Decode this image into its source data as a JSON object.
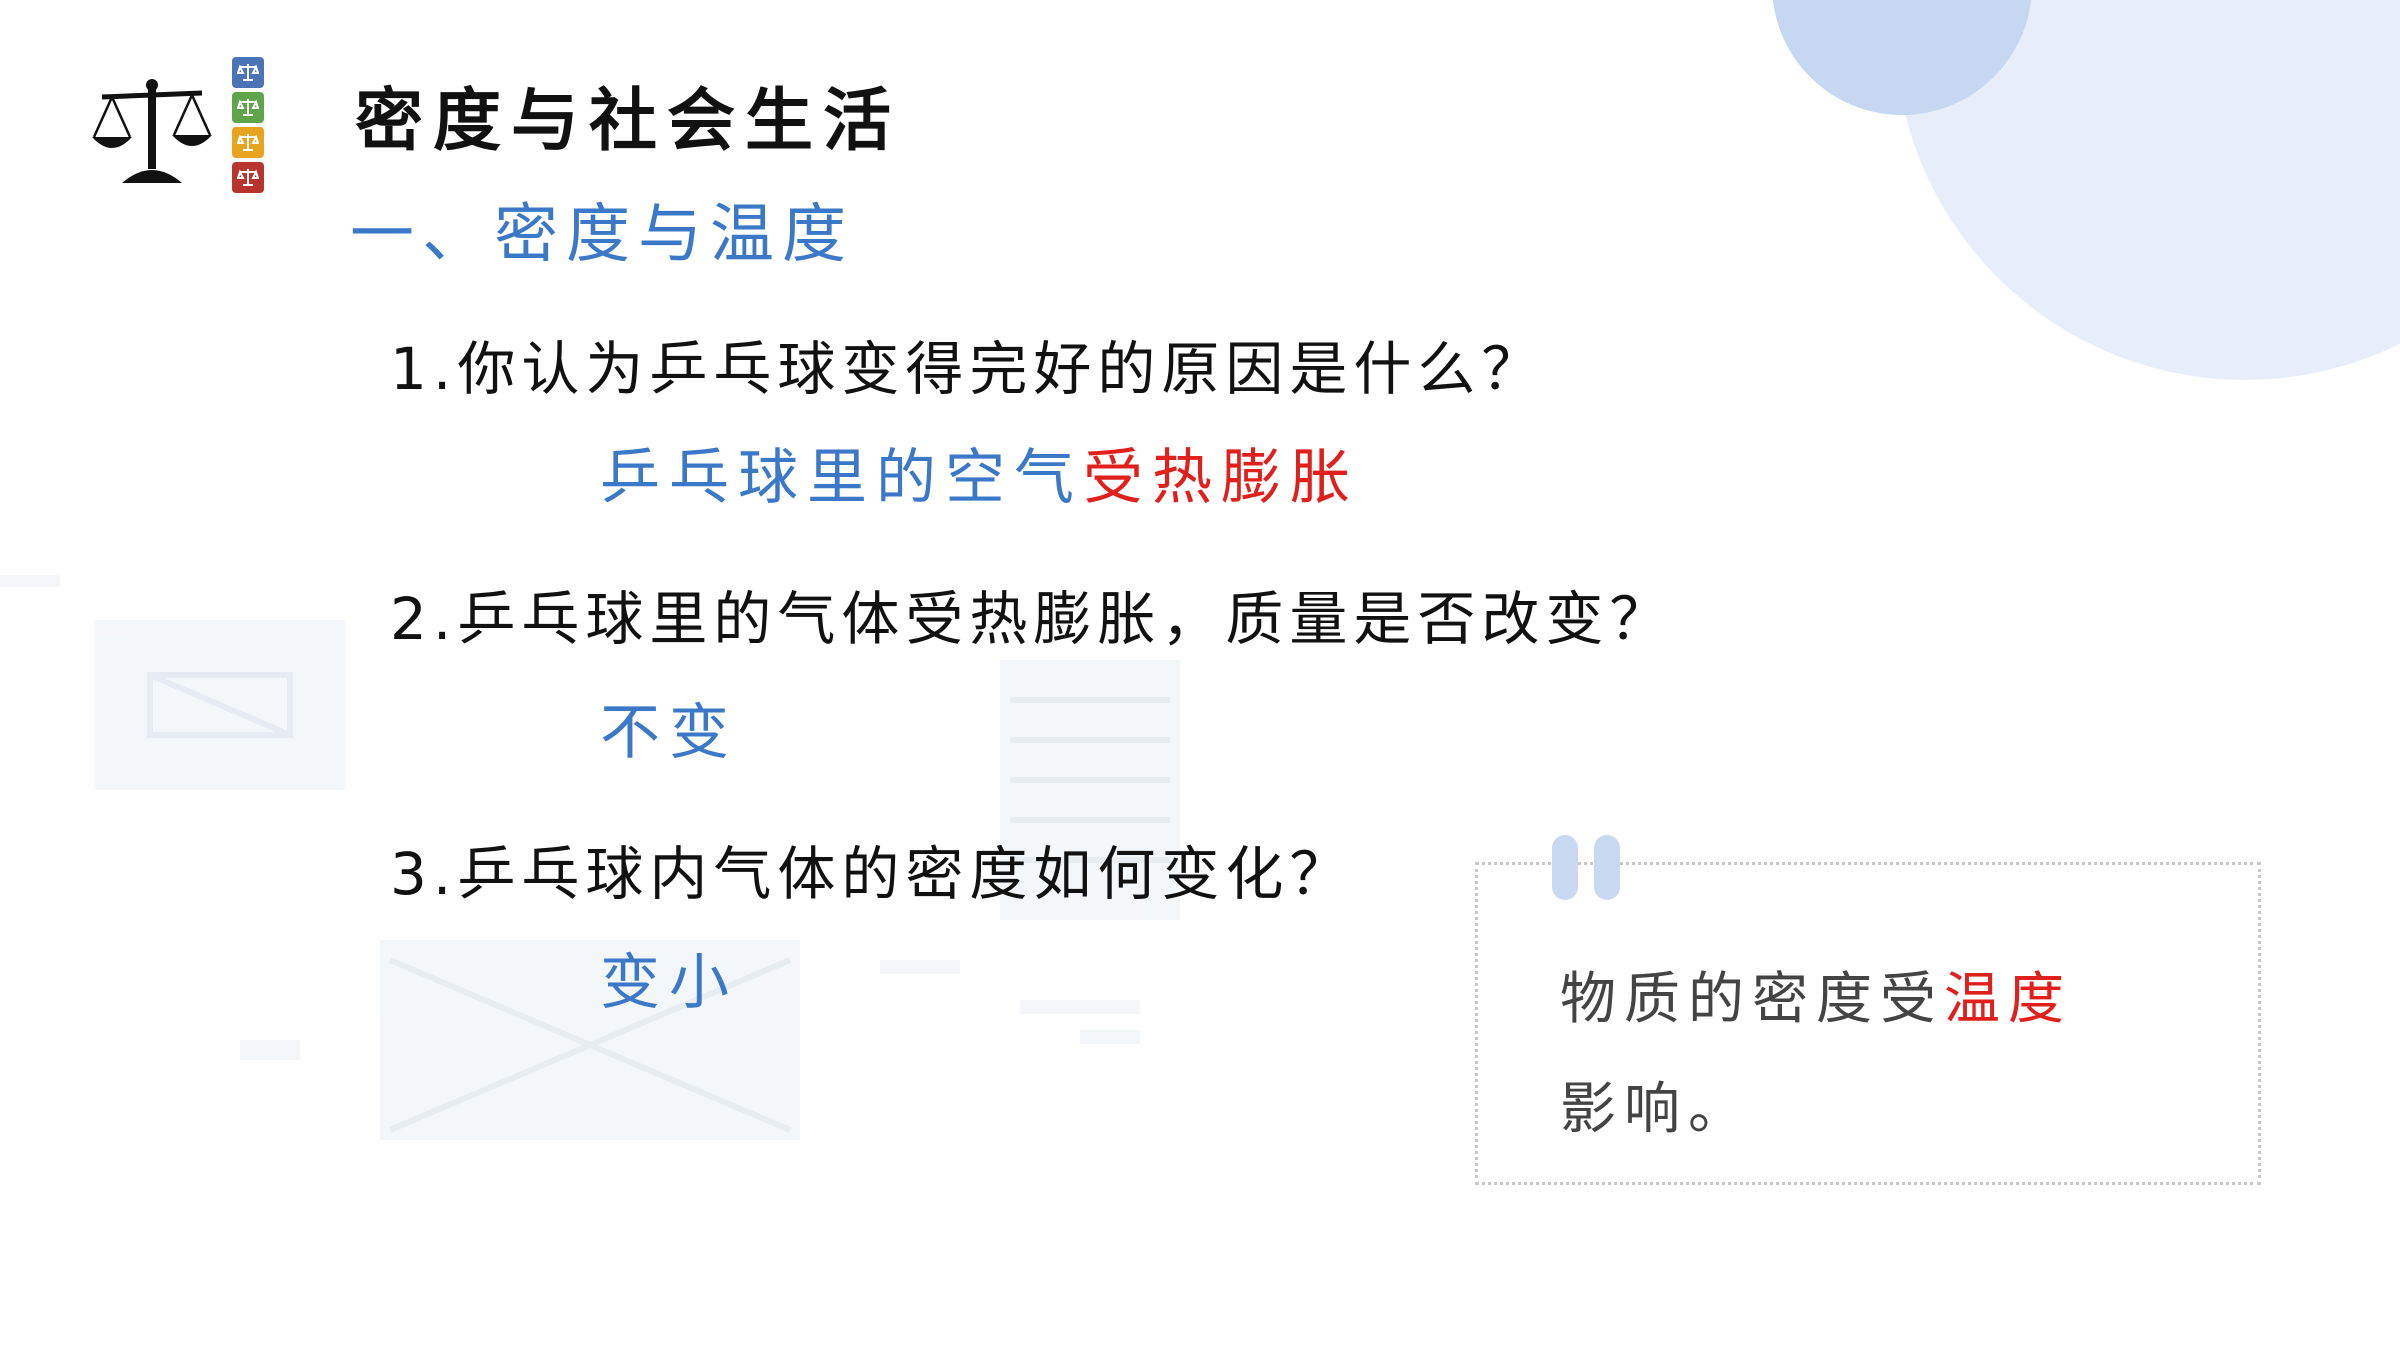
{
  "title": "密度与社会生活",
  "subtitle": "一、密度与温度",
  "questions": [
    {
      "text": "1.你认为乒乓球变得完好的原因是什么？"
    },
    {
      "text": "2.乒乓球里的气体受热膨胀，质量是否改变？"
    },
    {
      "text": "3.乒乓球内气体的密度如何变化？"
    }
  ],
  "answers": {
    "a1_part1": "乒乓球里的空气",
    "a1_part2": "受热膨胀",
    "a2": "不变",
    "a3": "变小"
  },
  "note": {
    "part1": "物质的密度受",
    "part2": "温度",
    "part3": "影响。"
  },
  "colors": {
    "blue": "#3b78c8",
    "red": "#e0201c",
    "logo_squares": [
      "#4a73b8",
      "#5fa34a",
      "#e8a31f",
      "#b8352e"
    ]
  },
  "icons": [
    "balance-scale-icon",
    "quote-mark-icon"
  ]
}
